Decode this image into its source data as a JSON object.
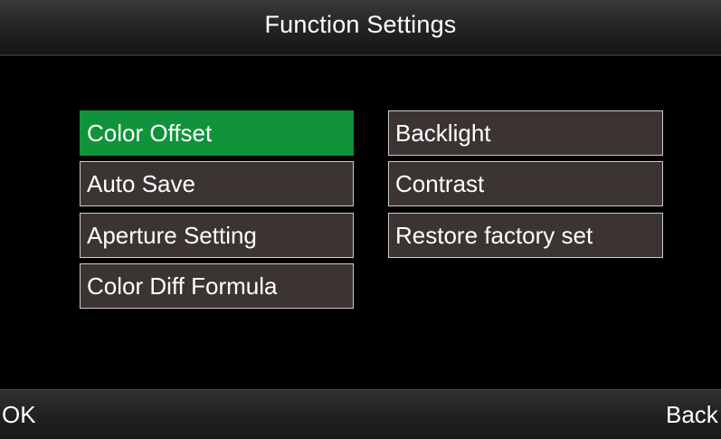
{
  "header": {
    "title": "Function Settings"
  },
  "menu": {
    "left_column": [
      {
        "label": "Color Offset",
        "selected": true
      },
      {
        "label": "Auto Save",
        "selected": false
      },
      {
        "label": "Aperture Setting",
        "selected": false
      },
      {
        "label": "Color Diff Formula",
        "selected": false
      }
    ],
    "right_column": [
      {
        "label": "Backlight",
        "selected": false
      },
      {
        "label": "Contrast",
        "selected": false
      },
      {
        "label": "Restore factory set",
        "selected": false
      }
    ]
  },
  "footer": {
    "left_softkey": "OK",
    "right_softkey": "Back"
  },
  "colors": {
    "selected_background": "#10933a",
    "button_background": "#3b3433",
    "button_border": "#cfcac8",
    "screen_background": "#000000"
  }
}
